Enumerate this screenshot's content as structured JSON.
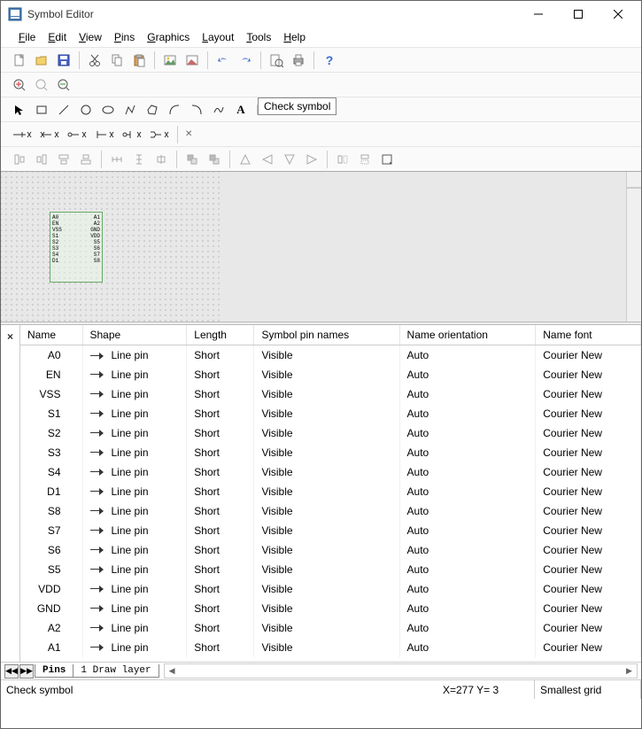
{
  "window": {
    "title": "Symbol Editor"
  },
  "menu": [
    "File",
    "Edit",
    "View",
    "Pins",
    "Graphics",
    "Layout",
    "Tools",
    "Help"
  ],
  "tooltip": "Check symbol",
  "symbol_pins": [
    [
      "A0",
      "A1"
    ],
    [
      "EN",
      "A2"
    ],
    [
      "VSS",
      "GND"
    ],
    [
      "S1",
      "VDD"
    ],
    [
      "S2",
      "S5"
    ],
    [
      "S3",
      "S6"
    ],
    [
      "S4",
      "S7"
    ],
    [
      "D1",
      "S8"
    ]
  ],
  "table": {
    "headers": [
      "Name",
      "Shape",
      "Length",
      "Symbol pin names",
      "Name orientation",
      "Name font"
    ],
    "rows": [
      {
        "name": "A0",
        "shape": "Line pin",
        "length": "Short",
        "vis": "Visible",
        "orient": "Auto",
        "font": "Courier New"
      },
      {
        "name": "EN",
        "shape": "Line pin",
        "length": "Short",
        "vis": "Visible",
        "orient": "Auto",
        "font": "Courier New"
      },
      {
        "name": "VSS",
        "shape": "Line pin",
        "length": "Short",
        "vis": "Visible",
        "orient": "Auto",
        "font": "Courier New"
      },
      {
        "name": "S1",
        "shape": "Line pin",
        "length": "Short",
        "vis": "Visible",
        "orient": "Auto",
        "font": "Courier New"
      },
      {
        "name": "S2",
        "shape": "Line pin",
        "length": "Short",
        "vis": "Visible",
        "orient": "Auto",
        "font": "Courier New"
      },
      {
        "name": "S3",
        "shape": "Line pin",
        "length": "Short",
        "vis": "Visible",
        "orient": "Auto",
        "font": "Courier New"
      },
      {
        "name": "S4",
        "shape": "Line pin",
        "length": "Short",
        "vis": "Visible",
        "orient": "Auto",
        "font": "Courier New"
      },
      {
        "name": "D1",
        "shape": "Line pin",
        "length": "Short",
        "vis": "Visible",
        "orient": "Auto",
        "font": "Courier New"
      },
      {
        "name": "S8",
        "shape": "Line pin",
        "length": "Short",
        "vis": "Visible",
        "orient": "Auto",
        "font": "Courier New"
      },
      {
        "name": "S7",
        "shape": "Line pin",
        "length": "Short",
        "vis": "Visible",
        "orient": "Auto",
        "font": "Courier New"
      },
      {
        "name": "S6",
        "shape": "Line pin",
        "length": "Short",
        "vis": "Visible",
        "orient": "Auto",
        "font": "Courier New"
      },
      {
        "name": "S5",
        "shape": "Line pin",
        "length": "Short",
        "vis": "Visible",
        "orient": "Auto",
        "font": "Courier New"
      },
      {
        "name": "VDD",
        "shape": "Line pin",
        "length": "Short",
        "vis": "Visible",
        "orient": "Auto",
        "font": "Courier New"
      },
      {
        "name": "GND",
        "shape": "Line pin",
        "length": "Short",
        "vis": "Visible",
        "orient": "Auto",
        "font": "Courier New"
      },
      {
        "name": "A2",
        "shape": "Line pin",
        "length": "Short",
        "vis": "Visible",
        "orient": "Auto",
        "font": "Courier New"
      },
      {
        "name": "A1",
        "shape": "Line pin",
        "length": "Short",
        "vis": "Visible",
        "orient": "Auto",
        "font": "Courier New"
      }
    ]
  },
  "sheets": {
    "active": "Pins",
    "other": "1 Draw layer"
  },
  "status": {
    "msg": "Check symbol",
    "coords": "X=277 Y=   3",
    "grid": "Smallest grid"
  }
}
